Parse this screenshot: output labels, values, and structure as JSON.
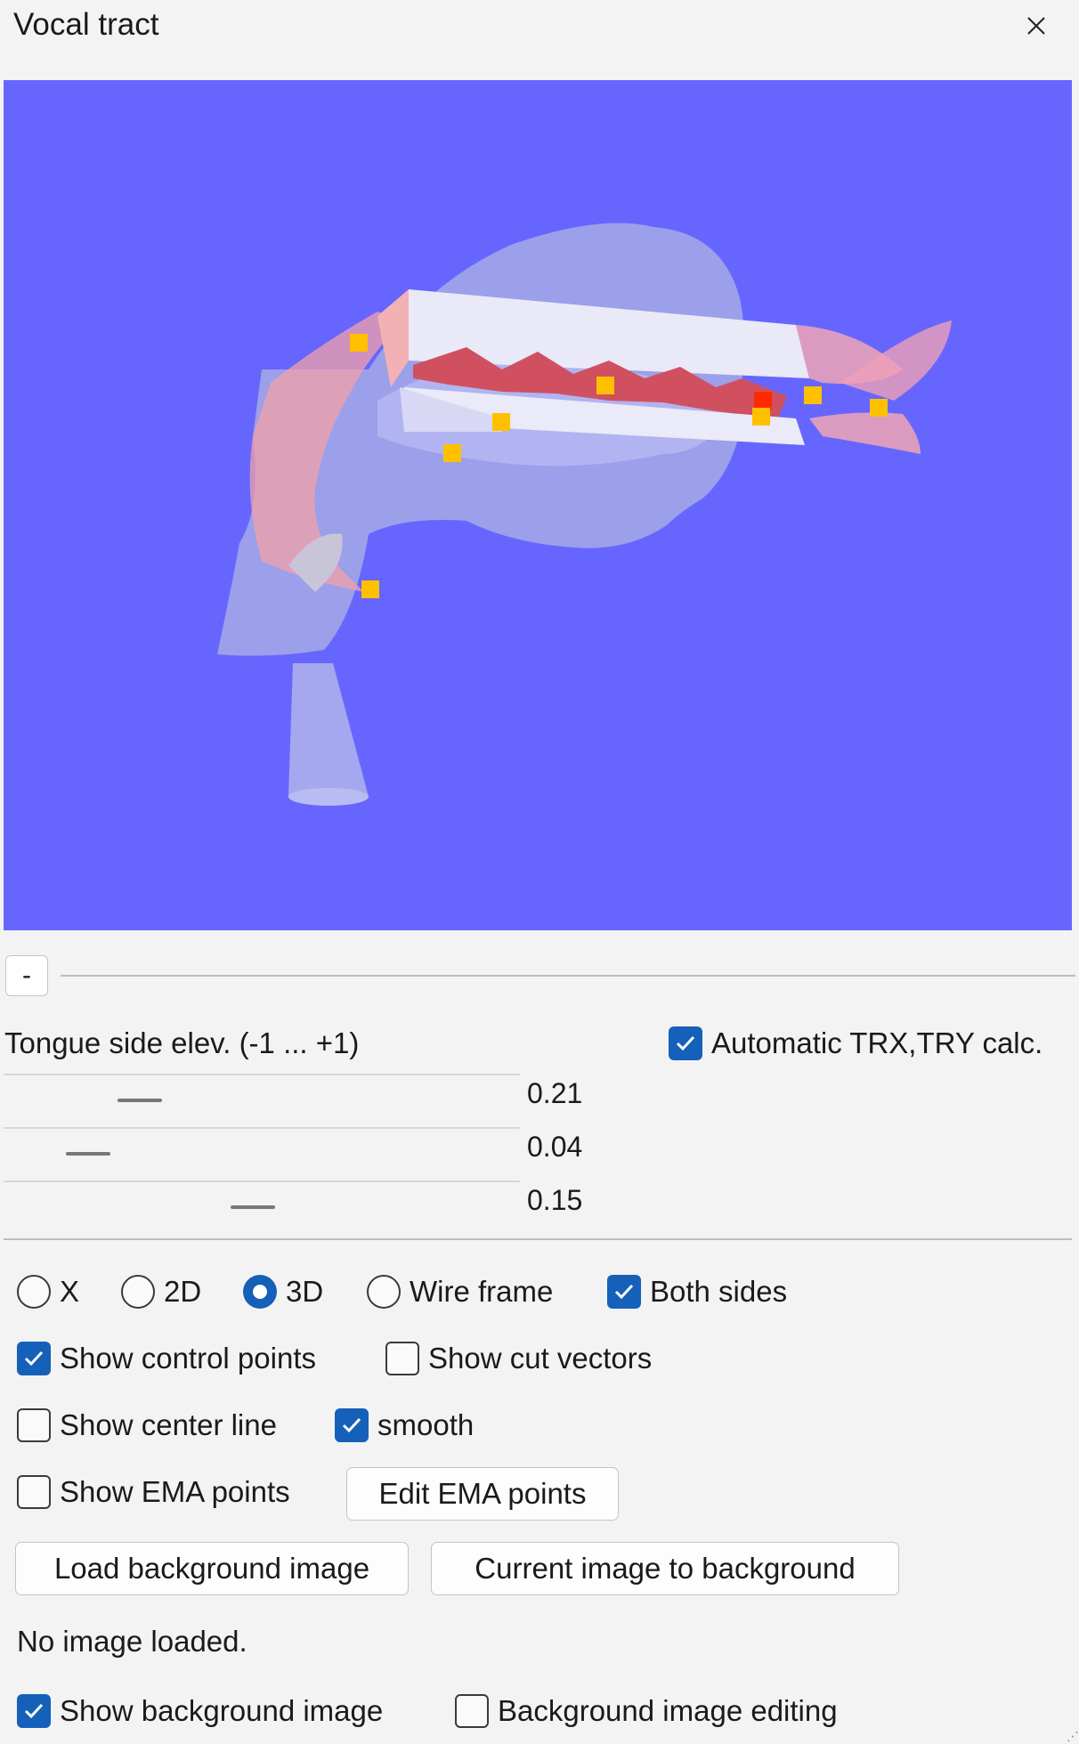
{
  "window": {
    "title": "Vocal tract",
    "close_icon": "close-icon"
  },
  "viewport": {
    "background_color": "#6666ff",
    "view_mode": "3D",
    "control_point_color": "#ffc000",
    "selected_point_color": "#ff2a00"
  },
  "collapse_button": {
    "label": "-"
  },
  "tongue": {
    "label": "Tongue side elev. (-1 ... +1)",
    "auto_calc_label": "Automatic TRX,TRY calc.",
    "auto_calc_checked": true,
    "sliders": [
      {
        "value": 0.21,
        "value_label": "0.21"
      },
      {
        "value": 0.04,
        "value_label": "0.04"
      },
      {
        "value": 0.15,
        "value_label": "0.15"
      }
    ]
  },
  "view_options": {
    "radio_x": "X",
    "radio_2d": "2D",
    "radio_3d": "3D",
    "radio_wireframe": "Wire frame",
    "selected": "3D",
    "both_sides": "Both sides",
    "show_control_points": "Show control points",
    "show_cut_vectors": "Show cut vectors",
    "show_center_line": "Show center line",
    "smooth": "smooth",
    "show_ema_points": "Show EMA points",
    "edit_ema_button": "Edit EMA points"
  },
  "background": {
    "load_button": "Load background image",
    "current_button": "Current image to background",
    "status": "No image loaded.",
    "show_label": "Show background image",
    "editing_label": "Background image editing"
  },
  "states": {
    "both_sides": true,
    "show_control_points": true,
    "show_cut_vectors": false,
    "show_center_line": false,
    "smooth": true,
    "show_ema_points": false,
    "show_background_image": true,
    "background_image_editing": false
  },
  "colors": {
    "accent": "#1560b8"
  }
}
